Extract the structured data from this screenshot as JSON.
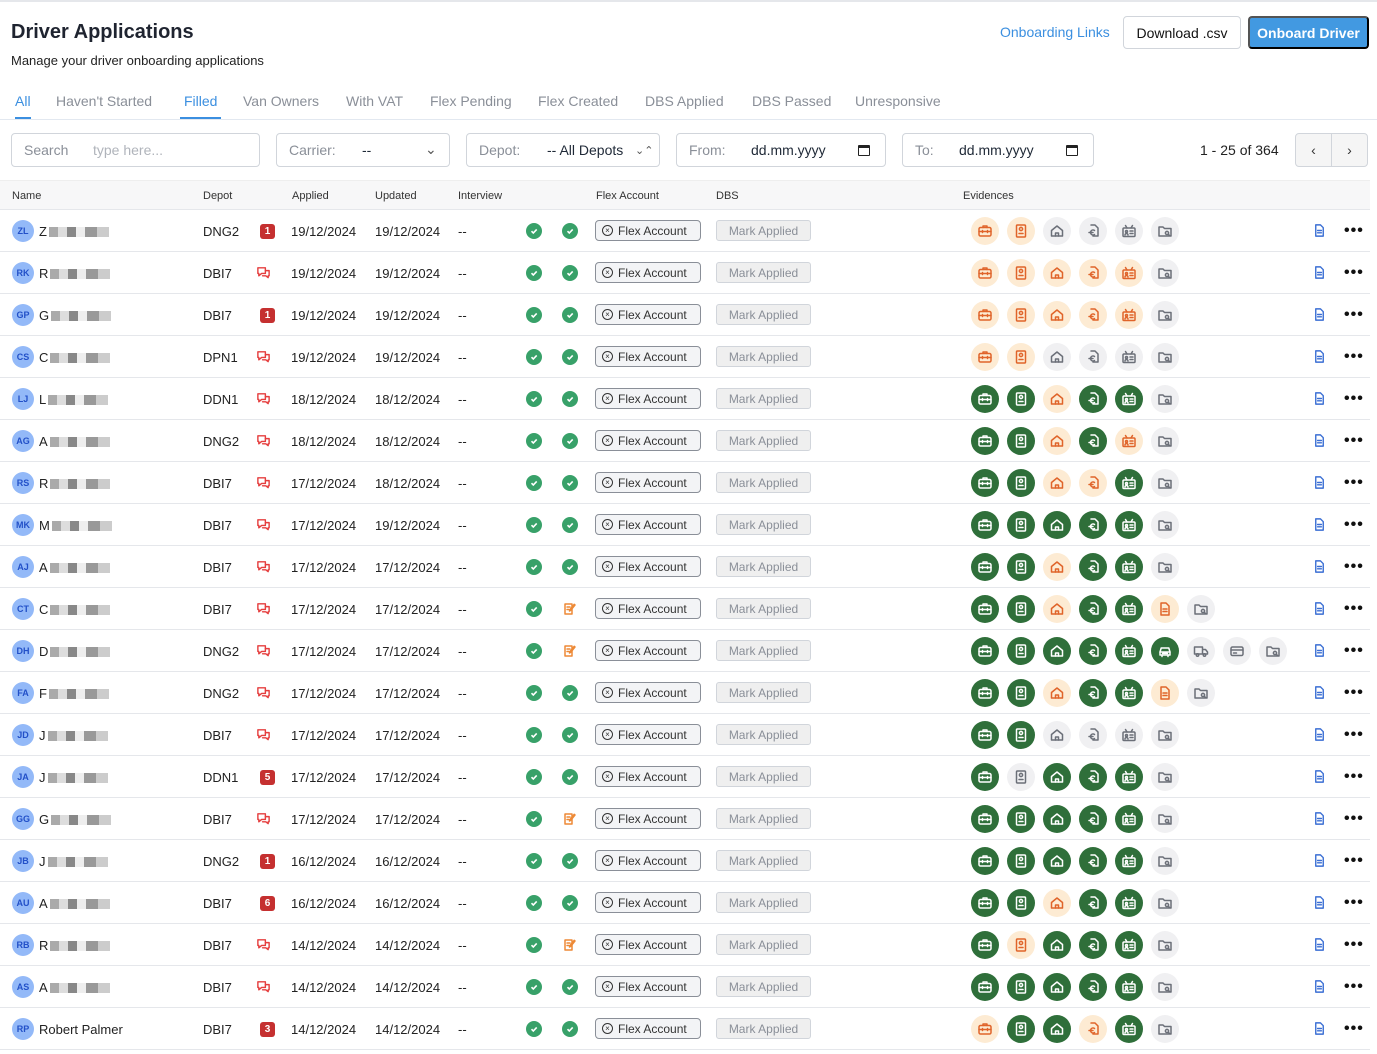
{
  "header": {
    "title": "Driver Applications",
    "subtitle": "Manage your driver onboarding applications",
    "onboarding_links": "Onboarding Links",
    "download_csv": "Download .csv",
    "onboard_driver": "Onboard Driver"
  },
  "tabs": [
    {
      "label": "All",
      "active": true
    },
    {
      "label": "Haven't Started"
    },
    {
      "label": "Filled",
      "active": true
    },
    {
      "label": "Van Owners"
    },
    {
      "label": "With VAT"
    },
    {
      "label": "Flex Pending"
    },
    {
      "label": "Flex Created"
    },
    {
      "label": "DBS Applied"
    },
    {
      "label": "DBS Passed"
    },
    {
      "label": "Unresponsive"
    }
  ],
  "filters": {
    "search_label": "Search",
    "search_placeholder": "type here...",
    "carrier_label": "Carrier:",
    "carrier_value": "--",
    "depot_label": "Depot:",
    "depot_value": "-- All Depots",
    "from_label": "From:",
    "from_value": "dd.mm.yyyy",
    "to_label": "To:",
    "to_value": "dd.mm.yyyy"
  },
  "pagination": {
    "text": "1 - 25 of 364",
    "prev": "‹",
    "next": "›"
  },
  "columns": {
    "name": "Name",
    "depot": "Depot",
    "applied": "Applied",
    "updated": "Updated",
    "interview": "Interview",
    "flex": "Flex Account",
    "dbs": "DBS",
    "evidences": "Evidences"
  },
  "labels": {
    "flex_account": "Flex Account",
    "mark_applied": "Mark Applied",
    "more": "•••"
  },
  "colors": {
    "accent": "#3b8fe0",
    "green": "#2f6f3a",
    "orange": "#e0642a",
    "badge": "#c53030"
  },
  "rows": [
    {
      "initials": "ZL",
      "name": "Z",
      "depot": "DNG2",
      "badge": "1",
      "applied": "19/12/2024",
      "updated": "19/12/2024",
      "interview": "--",
      "status2": "check",
      "ev": [
        "o",
        "o",
        "n",
        "n",
        "n",
        "n"
      ]
    },
    {
      "initials": "RK",
      "name": "R",
      "depot": "DBI7",
      "badge": null,
      "applied": "19/12/2024",
      "updated": "19/12/2024",
      "interview": "--",
      "status2": "check",
      "ev": [
        "o",
        "o",
        "o",
        "o",
        "o",
        "n"
      ]
    },
    {
      "initials": "GP",
      "name": "G",
      "depot": "DBI7",
      "badge": "1",
      "applied": "19/12/2024",
      "updated": "19/12/2024",
      "interview": "--",
      "status2": "check",
      "ev": [
        "o",
        "o",
        "o",
        "o",
        "o",
        "n"
      ]
    },
    {
      "initials": "CS",
      "name": "C",
      "depot": "DPN1",
      "badge": null,
      "applied": "19/12/2024",
      "updated": "19/12/2024",
      "interview": "--",
      "status2": "check",
      "ev": [
        "o",
        "o",
        "n",
        "n",
        "n",
        "n"
      ]
    },
    {
      "initials": "LJ",
      "name": "L",
      "depot": "DDN1",
      "badge": null,
      "applied": "18/12/2024",
      "updated": "18/12/2024",
      "interview": "--",
      "status2": "check",
      "ev": [
        "g",
        "g",
        "o",
        "g",
        "g",
        "n"
      ]
    },
    {
      "initials": "AG",
      "name": "A",
      "depot": "DNG2",
      "badge": null,
      "applied": "18/12/2024",
      "updated": "18/12/2024",
      "interview": "--",
      "status2": "check",
      "ev": [
        "g",
        "g",
        "o",
        "g",
        "o",
        "n"
      ]
    },
    {
      "initials": "RS",
      "name": "R",
      "depot": "DBI7",
      "badge": null,
      "applied": "17/12/2024",
      "updated": "18/12/2024",
      "interview": "--",
      "status2": "check",
      "ev": [
        "g",
        "g",
        "o",
        "o",
        "g",
        "n"
      ]
    },
    {
      "initials": "MK",
      "name": "M",
      "depot": "DBI7",
      "badge": null,
      "applied": "17/12/2024",
      "updated": "19/12/2024",
      "interview": "--",
      "status2": "check",
      "ev": [
        "g",
        "g",
        "g",
        "g",
        "g",
        "n"
      ]
    },
    {
      "initials": "AJ",
      "name": "A",
      "depot": "DBI7",
      "badge": null,
      "applied": "17/12/2024",
      "updated": "17/12/2024",
      "interview": "--",
      "status2": "check",
      "ev": [
        "g",
        "g",
        "o",
        "g",
        "g",
        "n"
      ]
    },
    {
      "initials": "CT",
      "name": "C",
      "depot": "DBI7",
      "badge": null,
      "applied": "17/12/2024",
      "updated": "17/12/2024",
      "interview": "--",
      "status2": "edit",
      "ev": [
        "g",
        "g",
        "o",
        "g",
        "g",
        "o:doc",
        "n"
      ]
    },
    {
      "initials": "DH",
      "name": "D",
      "depot": "DNG2",
      "badge": null,
      "applied": "17/12/2024",
      "updated": "17/12/2024",
      "interview": "--",
      "status2": "edit",
      "ev": [
        "g",
        "g",
        "g",
        "g",
        "g",
        "g:car",
        "n:truck",
        "n:card",
        "n"
      ]
    },
    {
      "initials": "FA",
      "name": "F",
      "depot": "DNG2",
      "badge": null,
      "applied": "17/12/2024",
      "updated": "17/12/2024",
      "interview": "--",
      "status2": "check",
      "ev": [
        "g",
        "g",
        "o",
        "g",
        "g",
        "o:doc",
        "n"
      ]
    },
    {
      "initials": "JD",
      "name": "J",
      "depot": "DBI7",
      "badge": null,
      "applied": "17/12/2024",
      "updated": "17/12/2024",
      "interview": "--",
      "status2": "check",
      "ev": [
        "g",
        "g",
        "n",
        "n",
        "n",
        "n"
      ]
    },
    {
      "initials": "JA",
      "name": "J",
      "depot": "DDN1",
      "badge": "5",
      "applied": "17/12/2024",
      "updated": "17/12/2024",
      "interview": "--",
      "status2": "check",
      "ev": [
        "g",
        "n",
        "g",
        "g",
        "g",
        "n"
      ]
    },
    {
      "initials": "GG",
      "name": "G",
      "depot": "DBI7",
      "badge": null,
      "applied": "17/12/2024",
      "updated": "17/12/2024",
      "interview": "--",
      "status2": "edit",
      "ev": [
        "g",
        "g",
        "g",
        "g",
        "g",
        "n"
      ]
    },
    {
      "initials": "JB",
      "name": "J",
      "depot": "DNG2",
      "badge": "1",
      "applied": "16/12/2024",
      "updated": "16/12/2024",
      "interview": "--",
      "status2": "check",
      "ev": [
        "g",
        "g",
        "g",
        "g",
        "g",
        "n"
      ]
    },
    {
      "initials": "AU",
      "name": "A",
      "depot": "DBI7",
      "badge": "6",
      "applied": "16/12/2024",
      "updated": "16/12/2024",
      "interview": "--",
      "status2": "check",
      "ev": [
        "g",
        "g",
        "o",
        "g",
        "g",
        "n"
      ]
    },
    {
      "initials": "RB",
      "name": "R",
      "depot": "DBI7",
      "badge": null,
      "applied": "14/12/2024",
      "updated": "14/12/2024",
      "interview": "--",
      "status2": "edit",
      "ev": [
        "g",
        "o",
        "g",
        "g",
        "g",
        "n"
      ]
    },
    {
      "initials": "AS",
      "name": "A",
      "depot": "DBI7",
      "badge": null,
      "applied": "14/12/2024",
      "updated": "14/12/2024",
      "interview": "--",
      "status2": "check",
      "ev": [
        "g",
        "g",
        "g",
        "g",
        "g",
        "n"
      ]
    },
    {
      "initials": "RP",
      "name": "Robert Palmer",
      "depot": "DBI7",
      "badge": "3",
      "applied": "14/12/2024",
      "updated": "14/12/2024",
      "interview": "--",
      "status2": "check",
      "ev": [
        "o",
        "g",
        "g",
        "o",
        "g",
        "n"
      ]
    }
  ]
}
